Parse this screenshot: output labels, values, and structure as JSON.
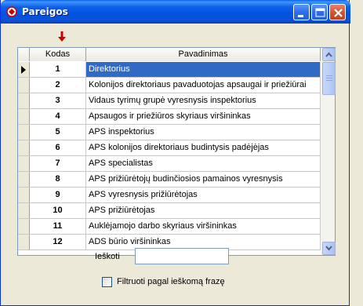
{
  "window": {
    "title": "Pareigos",
    "icon": "app-icon"
  },
  "titlebar_buttons": [
    "minimize-icon",
    "maximize-icon",
    "close-icon"
  ],
  "grid": {
    "columns": [
      "Kodas",
      "Pavadinimas"
    ],
    "selected_row": 0,
    "rows": [
      {
        "kodas": "1",
        "pavadinimas": "Direktorius"
      },
      {
        "kodas": "2",
        "pavadinimas": "Kolonijos direktoriaus pavaduotojas apsaugai ir priežiūrai"
      },
      {
        "kodas": "3",
        "pavadinimas": "Vidaus tyrimų grupė  vyresnysis inspektorius"
      },
      {
        "kodas": "4",
        "pavadinimas": "Apsaugos ir priežiūros skyriaus  viršininkas"
      },
      {
        "kodas": "5",
        "pavadinimas": "APS inspektorius"
      },
      {
        "kodas": "6",
        "pavadinimas": "APS  kolonijos direktoriaus budintysis padėjėjas"
      },
      {
        "kodas": "7",
        "pavadinimas": "APS  specialistas"
      },
      {
        "kodas": "8",
        "pavadinimas": "APS  prižiūrėtojų budinčiosios pamainos vyresnysis"
      },
      {
        "kodas": "9",
        "pavadinimas": "APS  vyresnysis prižiūrėtojas"
      },
      {
        "kodas": "10",
        "pavadinimas": "APS  prižiūrėtojas"
      },
      {
        "kodas": "11",
        "pavadinimas": "Auklėjamojo darbo skyriaus viršininkas"
      },
      {
        "kodas": "12",
        "pavadinimas": "ADS  būrio viršininkas"
      }
    ]
  },
  "search": {
    "label": "Ieškoti",
    "value": ""
  },
  "filter": {
    "label": "Filtruoti pagal ieškomą frazę",
    "checked": false
  },
  "colors": {
    "titlebar": "#0052e0",
    "selection": "#316ac5",
    "sort_arrow": "#cc0000"
  }
}
